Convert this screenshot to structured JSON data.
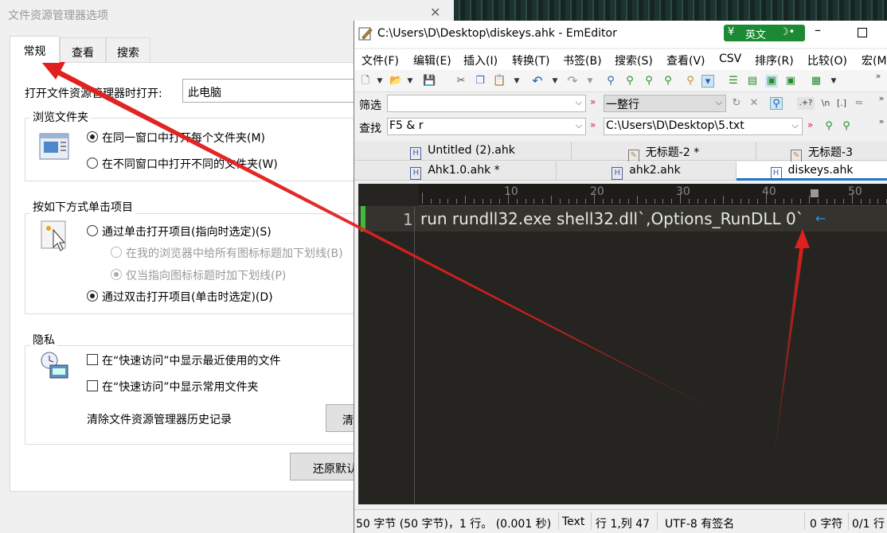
{
  "folder_options": {
    "title": "文件资源管理器选项",
    "tabs": [
      "常规",
      "查看",
      "搜索"
    ],
    "open_label": "打开文件资源管理器时打开:",
    "open_value": "此电脑",
    "browse": {
      "title": "浏览文件夹",
      "opt1": "在同一窗口中打开每个文件夹(M)",
      "opt2": "在不同窗口中打开不同的文件夹(W)"
    },
    "click": {
      "title": "按如下方式单击项目",
      "opt1": "通过单击打开项目(指向时选定)(S)",
      "sub1": "在我的浏览器中给所有图标标题加下划线(B)",
      "sub2": "仅当指向图标标题时加下划线(P)",
      "opt2": "通过双击打开项目(单击时选定)(D)"
    },
    "privacy": {
      "title": "隐私",
      "cb1": "在“快速访问”中显示最近使用的文件",
      "cb2": "在“快速访问”中显示常用文件夹",
      "clear_label": "清除文件资源管理器历史记录",
      "clear_button": "清"
    },
    "restore_button": "还原默认"
  },
  "emeditor": {
    "title": "C:\\Users\\D\\Desktop\\diskeys.ahk - EmEditor",
    "ime": "英文",
    "menu": [
      "文件(F)",
      "编辑(E)",
      "插入(I)",
      "转换(T)",
      "书签(B)",
      "搜索(S)",
      "查看(V)",
      "CSV",
      "排序(R)",
      "比较(O)",
      "宏(M"
    ],
    "filter_label": "筛选",
    "filter_value": "",
    "filter_mode": "一整行",
    "find_label": "查找",
    "find_value": "F5 & r",
    "find_path": "C:\\Users\\D\\Desktop\\5.txt",
    "tabs_row1": [
      "Untitled (2).ahk",
      "无标题-2 *",
      "无标题-3"
    ],
    "tabs_row2": [
      "Ahk1.0.ahk *",
      "ahk2.ahk",
      "diskeys.ahk"
    ],
    "ruler": [
      "10",
      "20",
      "30",
      "40",
      "50"
    ],
    "line_number": "1",
    "code": "run rundll32.exe shell32.dll`,Options_RunDLL 0`",
    "status": {
      "bytes": "50 字节 (50 字节)，1 行。 (0.001 秒)",
      "mode": "Text",
      "pos": "行 1,列 47",
      "enc": "UTF-8 有签名",
      "sel": "0 字符",
      "page": "0/1 行"
    }
  },
  "colors": {
    "arrow": "#e0201e",
    "editor_bg": "#262420",
    "ime": "#1b8a33"
  }
}
